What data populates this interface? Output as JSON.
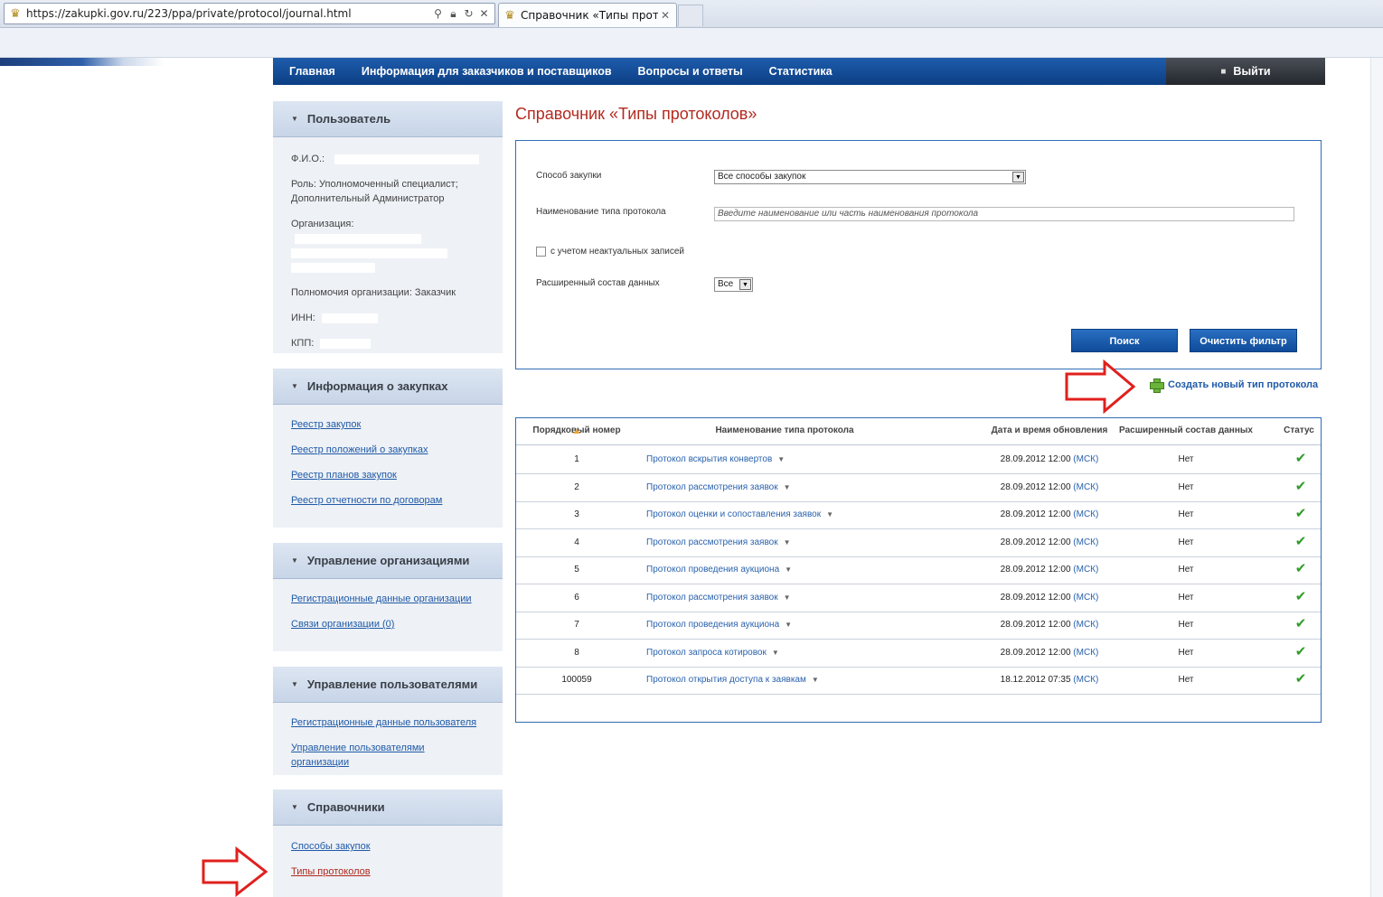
{
  "browser": {
    "url": "https://zakupki.gov.ru/223/ppa/private/protocol/journal.html",
    "tab_title": "Справочник «Типы протоко...",
    "favicon": "coat-of-arms-icon"
  },
  "nav": {
    "items": [
      "Главная",
      "Информация для заказчиков и поставщиков",
      "Вопросы и ответы",
      "Статистика"
    ],
    "logout": "Выйти"
  },
  "sidebar": {
    "user": {
      "title": "Пользователь",
      "fio_label": "Ф.И.О.:",
      "role_line1": "Роль: Уполномоченный специалист;",
      "role_line2": "Дополнительный Администратор",
      "org_label": "Организация:",
      "authority": "Полномочия организации: Заказчик",
      "inn_label": "ИНН:",
      "kpp_label": "КПП:"
    },
    "purchases": {
      "title": "Информация о закупках",
      "links": [
        "Реестр закупок",
        "Реестр положений о закупках",
        "Реестр планов закупок",
        "Реестр отчетности по договорам"
      ]
    },
    "orgs": {
      "title": "Управление организациями",
      "links": [
        "Регистрационные данные организации",
        "Связи организации (0)"
      ]
    },
    "users": {
      "title": "Управление пользователями",
      "links": [
        "Регистрационные данные пользователя",
        "Управление пользователями организации"
      ]
    },
    "refs": {
      "title": "Справочники",
      "links": [
        "Способы закупок",
        "Типы протоколов"
      ]
    }
  },
  "main": {
    "title": "Справочник «Типы протоколов»",
    "filter": {
      "method_label": "Способ закупки",
      "method_value": "Все способы закупок",
      "name_label": "Наименование типа протокола",
      "name_placeholder": "Введите наименование или часть наименования протокола",
      "inactive_label": "с учетом неактуальных записей",
      "extended_label": "Расширенный состав данных",
      "extended_value": "Все",
      "search_btn": "Поиск",
      "clear_btn": "Очистить фильтр"
    },
    "create_link": "Создать новый тип протокола",
    "table": {
      "headers": [
        "Порядковый номер",
        "Наименование типа протокола",
        "Дата и время обновления",
        "Расширенный состав данных",
        "Статус"
      ],
      "rows": [
        {
          "num": "1",
          "name": "Протокол вскрытия конвертов",
          "date": "28.09.2012 12:00",
          "tz": "(МСК)",
          "ext": "Нет"
        },
        {
          "num": "2",
          "name": "Протокол рассмотрения заявок",
          "date": "28.09.2012 12:00",
          "tz": "(МСК)",
          "ext": "Нет"
        },
        {
          "num": "3",
          "name": "Протокол оценки и сопоставления заявок",
          "date": "28.09.2012 12:00",
          "tz": "(МСК)",
          "ext": "Нет"
        },
        {
          "num": "4",
          "name": "Протокол рассмотрения заявок",
          "date": "28.09.2012 12:00",
          "tz": "(МСК)",
          "ext": "Нет"
        },
        {
          "num": "5",
          "name": "Протокол проведения аукциона",
          "date": "28.09.2012 12:00",
          "tz": "(МСК)",
          "ext": "Нет"
        },
        {
          "num": "6",
          "name": "Протокол рассмотрения заявок",
          "date": "28.09.2012 12:00",
          "tz": "(МСК)",
          "ext": "Нет"
        },
        {
          "num": "7",
          "name": "Протокол проведения аукциона",
          "date": "28.09.2012 12:00",
          "tz": "(МСК)",
          "ext": "Нет"
        },
        {
          "num": "8",
          "name": "Протокол запроса котировок",
          "date": "28.09.2012 12:00",
          "tz": "(МСК)",
          "ext": "Нет"
        },
        {
          "num": "100059",
          "name": "Протокол открытия доступа к заявкам",
          "date": "18.12.2012 07:35",
          "tz": "(МСК)",
          "ext": "Нет"
        }
      ]
    }
  },
  "colors": {
    "nav_blue": "#0c3f84",
    "title_red": "#b32a21",
    "link_blue": "#1f5aa7",
    "status_green": "#2f9d2a",
    "arrow_red": "#e0201d"
  }
}
